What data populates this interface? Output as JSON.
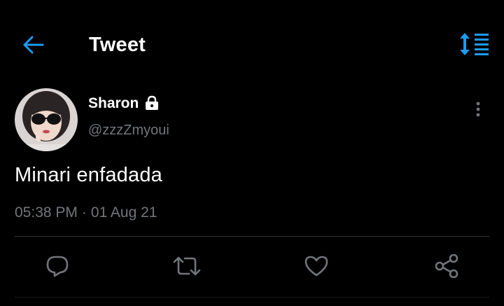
{
  "header": {
    "title": "Tweet",
    "back_icon": "arrow-left-icon",
    "sort_icon": "sort-list-icon",
    "accent_color": "#1d9bf0"
  },
  "tweet": {
    "author": {
      "name": "Sharon",
      "handle": "@zzzZmyoui",
      "protected_icon": "lock-icon",
      "avatar": "profile-photo"
    },
    "text": "Minari enfadada",
    "time": "05:38 PM",
    "separator": "·",
    "date": "01 Aug 21"
  },
  "actions": [
    {
      "icon": "reply-icon"
    },
    {
      "icon": "retweet-icon"
    },
    {
      "icon": "like-icon"
    },
    {
      "icon": "share-icon"
    }
  ],
  "colors": {
    "background": "#000000",
    "text": "#ffffff",
    "secondary_text": "#71767b",
    "divider": "#2f3336"
  }
}
